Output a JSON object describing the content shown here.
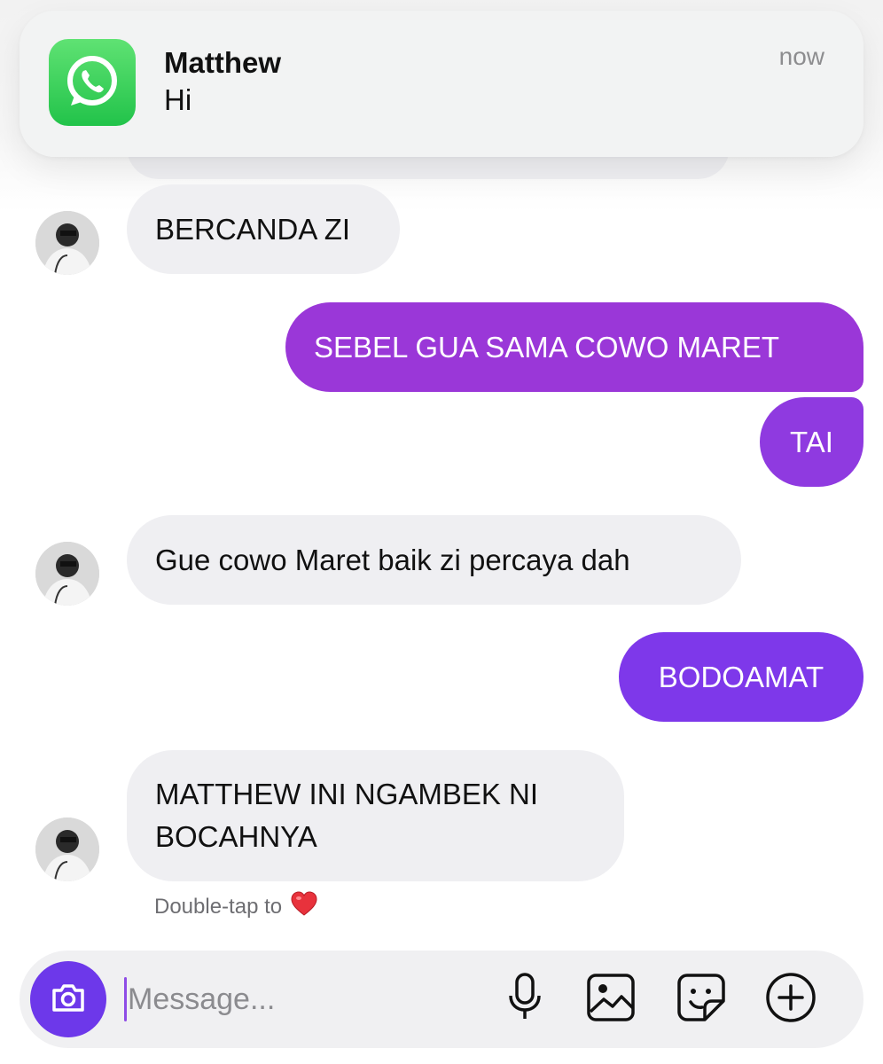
{
  "notification": {
    "app_icon": "whatsapp-icon",
    "title": "Matthew",
    "body": "Hi",
    "time": "now"
  },
  "messages": [
    {
      "direction": "incoming",
      "text": "BERCANDA ZI"
    },
    {
      "direction": "outgoing",
      "text": "SEBEL GUA SAMA COWO MARET"
    },
    {
      "direction": "outgoing",
      "text": "TAI"
    },
    {
      "direction": "incoming",
      "text": "Gue cowo Maret baik zi percaya dah"
    },
    {
      "direction": "outgoing",
      "text": "BODOAMAT"
    },
    {
      "direction": "incoming",
      "text": "MATTHEW INI NGAMBEK NI BOCAHNYA"
    }
  ],
  "hint": {
    "text": "Double-tap to",
    "icon": "red-heart-icon"
  },
  "composer": {
    "placeholder": "Message...",
    "icons": [
      "camera-icon",
      "microphone-icon",
      "image-icon",
      "sticker-icon",
      "plus-circle-icon"
    ]
  },
  "colors": {
    "outgoing_bubble_start": "#9a37d8",
    "outgoing_bubble_end": "#7e38ea",
    "incoming_bubble": "#efeff2",
    "camera_button": "#6d38ea",
    "whatsapp_green": "#25d366"
  }
}
